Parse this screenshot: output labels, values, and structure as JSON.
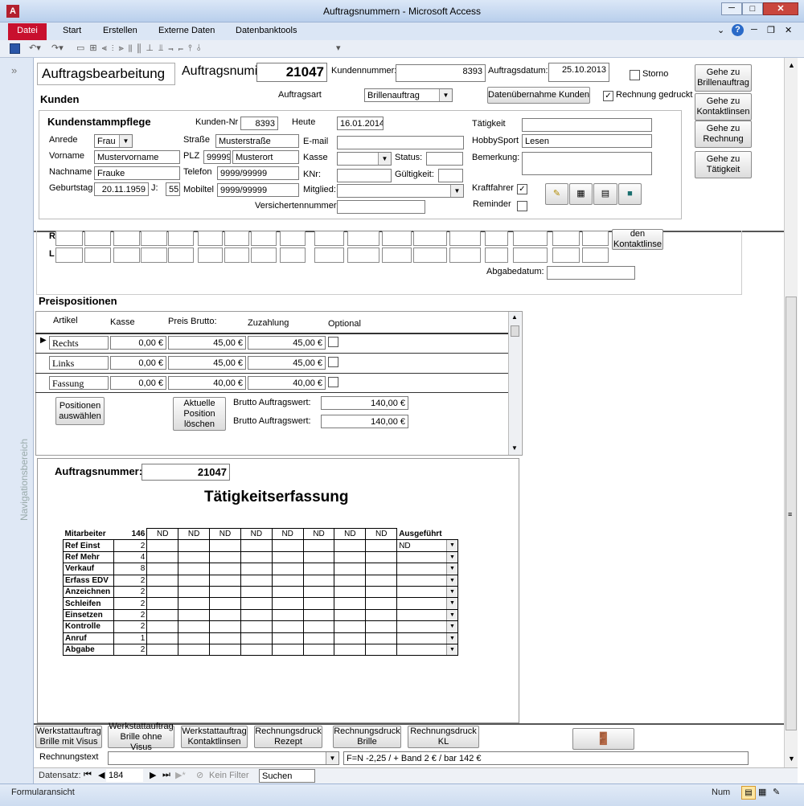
{
  "window": {
    "title": "Auftragsnummern - Microsoft Access"
  },
  "ribbon": {
    "tabs": [
      "Datei",
      "Start",
      "Erstellen",
      "Externe Daten",
      "Datenbanktools"
    ]
  },
  "nav_pane": {
    "label": "Navigationsbereich"
  },
  "header": {
    "form_title": "Auftragsbearbeitung",
    "order_label": "Auftragsnumi",
    "order_value": "21047",
    "customer_no_label": "Kundennummer:",
    "customer_no_value": "8393",
    "order_date_label": "Auftragsdatum:",
    "order_date_value": "25.10.2013",
    "storno_label": "Storno",
    "order_type_label": "Auftragsart",
    "order_type_value": "Brillenauftrag",
    "import_button": "Datenübernahme Kunden",
    "invoice_printed_label": "Rechnung gedruckt"
  },
  "side_buttons": [
    "Gehe zu Brillenauftrag",
    "Gehe zu Kontaktlinsen",
    "Gehe zu Rechnung",
    "Gehe zu Tätigkeit"
  ],
  "kunden": {
    "section_title": "Kunden",
    "subform_title": "Kundenstammpflege",
    "anrede_label": "Anrede",
    "anrede_value": "Frau",
    "vorname_label": "Vorname",
    "vorname_value": "Mustervorname",
    "nachname_label": "Nachname",
    "nachname_value": "Frauke",
    "geburtstag_label": "Geburtstag",
    "geburtstag_value": "20.11.1959",
    "j_label": "J:",
    "j_value": "55",
    "kundennr_label": "Kunden-Nr",
    "kundennr_value": "8393",
    "heute_label": "Heute",
    "heute_value": "16.01.2014",
    "strasse_label": "Straße",
    "strasse_value": "Musterstraße",
    "plz_label": "PLZ",
    "plz_value": "99999",
    "ort_value": "Musterort",
    "telefon_label": "Telefon",
    "telefon_value": "9999/99999",
    "mobiltel_label": "Mobiltel",
    "mobiltel_value": "9999/99999",
    "email_label": "E-mail",
    "kasse_label": "Kasse",
    "status_label": "Status:",
    "knr_label": "KNr:",
    "gueltigkeit_label": "Gültigkeit:",
    "mitglied_label": "Mitglied:",
    "versicherten_label": "Versichertennummer:",
    "taetigkeit_label": "Tätigkeit",
    "hobby_label": "HobbySport",
    "hobby_value": "Lesen",
    "bemerkung_label": "Bemerkung:",
    "kraftfahrer_label": "Kraftfahrer",
    "reminder_label": "Reminder"
  },
  "refraction": {
    "row_r": "R",
    "row_l": "L",
    "kontakt_button": "den Kontaktlinse",
    "abgabe_label": "Abgabedatum:"
  },
  "preise": {
    "section_title": "Preispositionen",
    "headers": [
      "Artikel",
      "Kasse",
      "Preis Brutto:",
      "Zuzahlung",
      "Optional"
    ],
    "rows": [
      {
        "artikel": "Rechts",
        "kasse": "0,00 €",
        "preis": "45,00 €",
        "zuzahlung": "45,00 €"
      },
      {
        "artikel": "Links",
        "kasse": "0,00 €",
        "preis": "45,00 €",
        "zuzahlung": "45,00 €"
      },
      {
        "artikel": "Fassung",
        "kasse": "0,00 €",
        "preis": "40,00 €",
        "zuzahlung": "40,00 €"
      }
    ],
    "select_button": "Positionen auswählen",
    "delete_button": "Aktuelle Position löschen",
    "brutto1_label": "Brutto Auftragswert:",
    "brutto1_value": "140,00 €",
    "brutto2_label": "Brutto Auftragswert:",
    "brutto2_value": "140,00 €"
  },
  "taetigkeit": {
    "order_label": "Auftragsnummer:",
    "order_value": "21047",
    "title": "Tätigkeitserfassung",
    "head_mitarbeiter": "Mitarbeiter",
    "head_count": "146",
    "head_nd": [
      "ND",
      "ND",
      "ND",
      "ND",
      "ND",
      "ND",
      "ND",
      "ND"
    ],
    "head_ausgefuehrt": "Ausgeführt",
    "first_value": "ND",
    "rows": [
      {
        "name": "Ref Einst",
        "n": "2"
      },
      {
        "name": "Ref Mehr",
        "n": "4"
      },
      {
        "name": "Verkauf",
        "n": "8"
      },
      {
        "name": "Erfass EDV",
        "n": "2"
      },
      {
        "name": "Anzeichnen",
        "n": "2"
      },
      {
        "name": "Schleifen",
        "n": "2"
      },
      {
        "name": "Einsetzen",
        "n": "2"
      },
      {
        "name": "Kontrolle",
        "n": "2"
      },
      {
        "name": "Anruf",
        "n": "1"
      },
      {
        "name": "Abgabe",
        "n": "2"
      }
    ]
  },
  "bottom_buttons": [
    "Werkstattauftrag Brille mit Visus",
    "Werkstattauftrag Brille ohne Visus",
    "Werkstattauftrag Kontaktlinsen",
    "Rechnungsdruck Rezept",
    "Rechnungsdruck Brille",
    "Rechnungsdruck KL"
  ],
  "rechnungstext": {
    "label": "Rechnungstext",
    "formula": "F=N -2,25 / + Band 2 € / bar 142 €"
  },
  "record_nav": {
    "label": "Datensatz:",
    "current": "184",
    "filter": "Kein Filter",
    "search": "Suchen"
  },
  "statusbar": {
    "left": "Formularansicht",
    "right": "Num"
  },
  "colors": {
    "title_bg": "#c5d6ee",
    "file_tab": "#c8102e",
    "accent": "#1e5aa8"
  }
}
